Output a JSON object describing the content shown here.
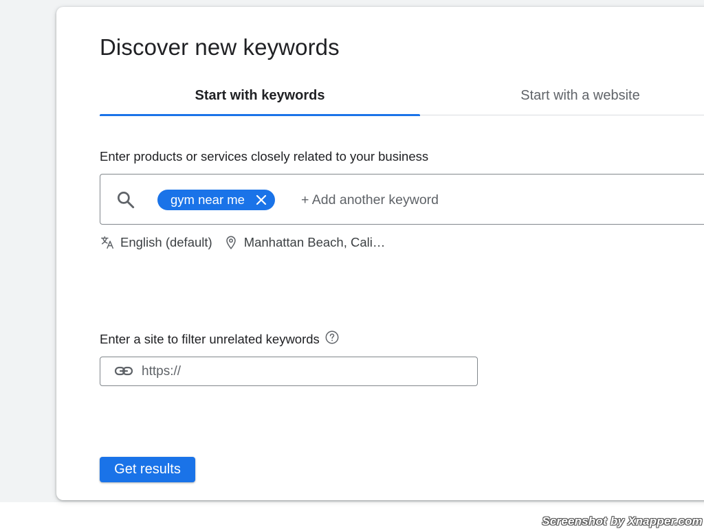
{
  "page": {
    "title": "Discover new keywords"
  },
  "tabs": [
    {
      "label": "Start with keywords",
      "active": true
    },
    {
      "label": "Start with a website",
      "active": false
    }
  ],
  "keywords_section": {
    "label": "Enter products or services closely related to your business",
    "chips": [
      {
        "label": "gym near me"
      }
    ],
    "input_placeholder": "+ Add another keyword",
    "input_value": ""
  },
  "targeting": {
    "language": "English (default)",
    "location": "Manhattan Beach, Cali…"
  },
  "site_filter": {
    "label": "Enter a site to filter unrelated keywords",
    "input_placeholder": "https://",
    "input_value": ""
  },
  "actions": {
    "submit_label": "Get results"
  },
  "watermark": "Screenshot by Xnapper.com",
  "icons": {
    "search": "search-icon",
    "chip_close": "close-icon",
    "language": "translate-icon",
    "location": "location-pin-icon",
    "help": "help-circle-icon",
    "link": "link-icon"
  },
  "colors": {
    "accent": "#1a73e8",
    "text_primary": "#202124",
    "text_secondary": "#5f6368",
    "border": "#80868b"
  }
}
